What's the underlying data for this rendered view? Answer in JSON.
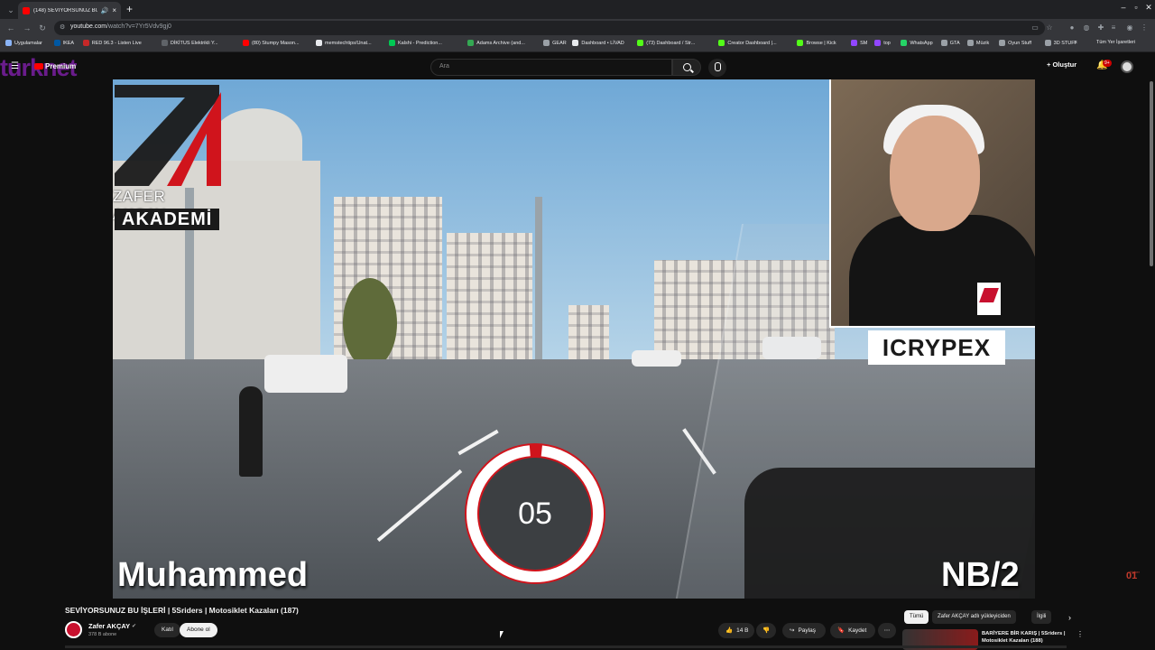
{
  "browser": {
    "tab_title": "(148) SEVİYORSUNUZ BU İŞ",
    "new_tab": "+",
    "url_host": "youtube.com",
    "url_path": "/watch?v=7Yr5Vdv9gj0",
    "bookmarks": [
      {
        "label": "Uygulamalar",
        "color": "#8ab4f8"
      },
      {
        "label": "IKEA",
        "color": "#0058a3"
      },
      {
        "label": "RED 96.3 - Listen Live",
        "color": "#c62828"
      },
      {
        "label": "DİKİTUS Elektrikli Y...",
        "color": "#5f6368"
      },
      {
        "label": "(80) Stumpy Mason...",
        "color": "#ff0000"
      },
      {
        "label": "memstechtips/Unat...",
        "color": "#e8eaed"
      },
      {
        "label": "Kalshi - Prediction...",
        "color": "#00c853"
      },
      {
        "label": "Adams Archive (and...",
        "color": "#34a853"
      },
      {
        "label": "GEAR",
        "color": "#9aa0a6"
      },
      {
        "label": "Dashboard • LİVAD",
        "color": "#e8eaed"
      },
      {
        "label": "(73) Dashboard / Str...",
        "color": "#53fc18"
      },
      {
        "label": "Creator Dashboard |...",
        "color": "#53fc18"
      },
      {
        "label": "Browse | Kick",
        "color": "#53fc18"
      },
      {
        "label": "SM",
        "color": "#9146ff"
      },
      {
        "label": "top",
        "color": "#9146ff"
      },
      {
        "label": "WhatsApp",
        "color": "#25d366"
      },
      {
        "label": "GTA",
        "color": "#9aa0a6"
      },
      {
        "label": "Müzik",
        "color": "#9aa0a6"
      },
      {
        "label": "Oyun Stuff",
        "color": "#9aa0a6"
      },
      {
        "label": "3D STUFF",
        "color": "#9aa0a6"
      }
    ],
    "all_bookmarks": "Tüm Yer İşaretleri"
  },
  "masthead": {
    "logo_text": "Premium",
    "isp_watermark": "turknet",
    "search_placeholder": "Ara",
    "create_label": "Oluştur",
    "notif_count": "9+"
  },
  "video": {
    "brand_name": "ZAFER AKÇAY",
    "brand_sub": "AKADEMİ",
    "sponsor": "ICRYPEX",
    "countdown": "05",
    "countdown_fraction": 0.97,
    "caption_left": "Muhammed",
    "caption_right": "NB/2",
    "side_watermark": "01",
    "side_watermark_small": "Haber"
  },
  "meta": {
    "title": "SEVİYORSUNUZ BU İŞLERİ | 5Sriders | Motosiklet Kazaları (187)",
    "channel": "Zafer AKÇAY",
    "subscribers": "378 B abone",
    "join": "Katıl",
    "subscribe": "Abone ol",
    "likes": "14 B",
    "share": "Paylaş",
    "save": "Kaydet"
  },
  "recommendations": {
    "chips": [
      "Tümü",
      "Zafer AKÇAY adlı yükleyiciden",
      "İlgili"
    ],
    "first_title": "BARİYERE BİR KARIŞ | 5Sriders | Motosiklet Kazaları (188)"
  },
  "colors": {
    "accent": "#ff0000",
    "brand_red": "#d0141c"
  }
}
